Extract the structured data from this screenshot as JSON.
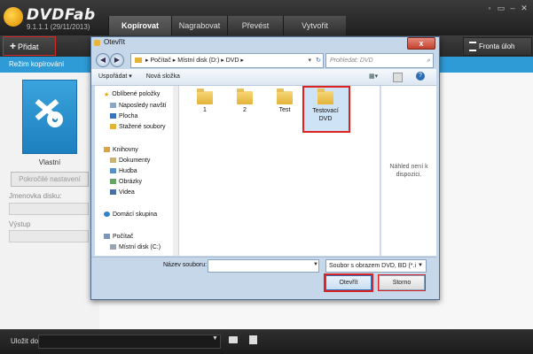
{
  "app": {
    "title": "DVDFab",
    "version": "9.1.1.1 (29/11/2013)",
    "tabs": [
      "Kopírovat",
      "Nagrabovat",
      "Převést",
      "Vytvořit"
    ],
    "active_tab": "Kopírovat",
    "window_controls": [
      "◦",
      "▭",
      "–",
      "✕"
    ]
  },
  "toolbar": {
    "add_label": "Přidat",
    "queue_label": "Fronta úloh"
  },
  "mode": {
    "label": "Režim kopírování"
  },
  "left_panel": {
    "profile_label": "Vlastní",
    "advanced_button": "Pokročilé nastavení",
    "volume_label": "Jmenovka disku:",
    "output_label": "Výstup"
  },
  "bottom": {
    "save_to_label": "Uložit do:",
    "save_to_value": ""
  },
  "dialog": {
    "title": "Otevřít",
    "close": "x",
    "address": {
      "segments": [
        "Počítač",
        "Místní disk (D:)",
        "DVD"
      ]
    },
    "search_placeholder": "Prohledat: DVD",
    "commands": {
      "organize": "Uspořádat ▾",
      "new_folder": "Nová složka"
    },
    "nav": {
      "favorites": "Oblíbené položky",
      "recent": "Naposledy navští",
      "desktop": "Plocha",
      "downloads": "Stažené soubory",
      "libraries": "Knihovny",
      "documents": "Dokumenty",
      "music": "Hudba",
      "pictures": "Obrázky",
      "videos": "Videa",
      "homegroup": "Domácí skupina",
      "computer": "Počítač",
      "local_disk": "Místní disk (C:)"
    },
    "folders": [
      "1",
      "2",
      "Test",
      "Testovací DVD"
    ],
    "preview_text": "Náhled není k dispozici.",
    "filename_label": "Název souboru:",
    "filename_value": "",
    "filetype_value": "Soubor s obrazem DVD, BD (*.i",
    "open_label": "Otevřít",
    "cancel_label": "Storno"
  },
  "colors": {
    "accent": "#2e9ad6",
    "highlight_border": "#dd2222"
  }
}
